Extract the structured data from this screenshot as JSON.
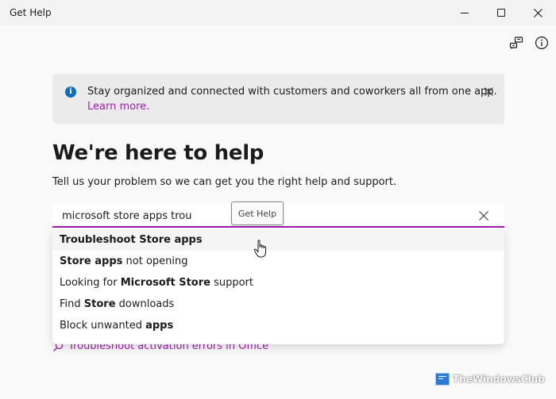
{
  "window": {
    "title": "Get Help"
  },
  "banner": {
    "message": "Stay organized and connected with customers and coworkers all from one app.",
    "link": "Learn more."
  },
  "main": {
    "headline": "We're here to help",
    "subtext": "Tell us your problem so we can get you the right help and support."
  },
  "search": {
    "value": "microsoft store apps trou",
    "tooltip": "Get Help"
  },
  "suggestions": [
    {
      "parts": [
        {
          "text": "Troubleshoot Store apps",
          "bold": true
        }
      ]
    },
    {
      "parts": [
        {
          "text": "Store apps",
          "bold": true
        },
        {
          "text": " not opening",
          "bold": false
        }
      ]
    },
    {
      "parts": [
        {
          "text": "Looking for ",
          "bold": false
        },
        {
          "text": "Microsoft Store",
          "bold": true
        },
        {
          "text": " support",
          "bold": false
        }
      ]
    },
    {
      "parts": [
        {
          "text": "Find ",
          "bold": false
        },
        {
          "text": "Store",
          "bold": true
        },
        {
          "text": " downloads",
          "bold": false
        }
      ]
    },
    {
      "parts": [
        {
          "text": "Block unwanted ",
          "bold": false
        },
        {
          "text": "apps",
          "bold": true
        }
      ]
    }
  ],
  "background_link": {
    "text": "Troubleshoot activation errors in Office"
  },
  "watermark": {
    "text": "TheWindowsClub"
  },
  "colors": {
    "accent": "#a21caf",
    "info_blue": "#0f6cbd"
  },
  "icons": {
    "feedback": "feedback-icon",
    "info": "info-icon",
    "close": "close-icon",
    "search": "search-icon"
  }
}
